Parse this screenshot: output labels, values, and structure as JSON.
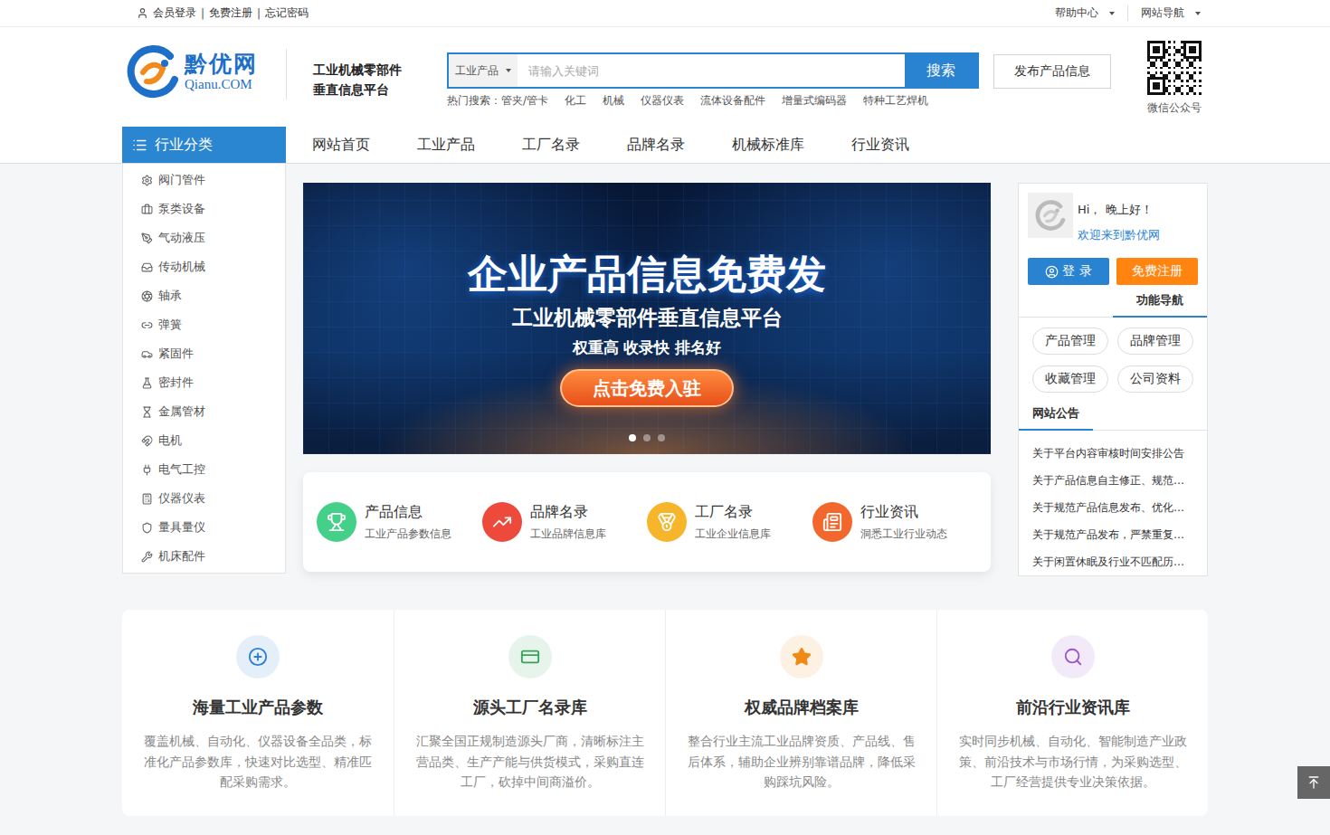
{
  "top_bar": {
    "left_links": [
      "会员登录",
      "免费注册",
      "忘记密码"
    ],
    "separator": "|",
    "right_menus": [
      "帮助中心",
      "网站导航"
    ]
  },
  "logo": {
    "name": "黔优网",
    "domain": "Qianu.COM"
  },
  "slogan": [
    "工业机械零部件",
    "垂直信息平台"
  ],
  "search": {
    "category": "工业产品",
    "placeholder": "请输入关键词",
    "button": "搜索",
    "hot_label": "热门搜索：",
    "hot": [
      "管夹/管卡",
      "化工",
      "机械",
      "仪器仪表",
      "流体设备配件",
      "增量式编码器",
      "特种工艺焊机"
    ]
  },
  "publish_button": "发布产品信息",
  "qr": {
    "caption": "微信公众号"
  },
  "category_title": "行业分类",
  "nav": [
    "网站首页",
    "工业产品",
    "工厂名录",
    "品牌名录",
    "机械标准库",
    "行业资讯"
  ],
  "sidebar": {
    "items": [
      "阀门管件",
      "泵类设备",
      "气动液压",
      "传动机械",
      "轴承",
      "弹簧",
      "紧固件",
      "密封件",
      "金属管材",
      "电机",
      "电气工控",
      "仪器仪表",
      "量具量仪",
      "机床配件"
    ]
  },
  "banner": {
    "title": "企业产品信息免费发",
    "subtitle": "工业机械零部件垂直信息平台",
    "tagline": "权重高 收录快 排名好",
    "button": "点击免费入驻",
    "dots": [
      {
        "selected": true
      },
      {
        "selected": false
      },
      {
        "selected": false
      }
    ]
  },
  "quick_links": [
    {
      "title": "产品信息",
      "desc": "工业产品参数信息",
      "color": "#45d08a"
    },
    {
      "title": "品牌名录",
      "desc": "工业品牌信息库",
      "color": "#ee4a3b"
    },
    {
      "title": "工厂名录",
      "desc": "工业企业信息库",
      "color": "#f6b52a"
    },
    {
      "title": "行业资讯",
      "desc": "洞悉工业行业动态",
      "color": "#f2682c"
    }
  ],
  "user_panel": {
    "greeting": "Hi， 晚上好！",
    "welcome": "欢迎来到黔优网",
    "login": "登 录",
    "register": "免费注册",
    "nav_title": "功能导航",
    "functions": [
      "产品管理",
      "品牌管理",
      "收藏管理",
      "公司资料"
    ],
    "notice_title": "网站公告",
    "notices": [
      "关于平台内容审核时间安排公告",
      "关于产品信息自主修正、规范…",
      "关于规范产品信息发布、优化…",
      "关于规范产品发布，严禁重复…",
      "关于闲置休眠及行业不匹配历…"
    ]
  },
  "features": [
    {
      "title": "海量工业产品参数",
      "desc": "覆盖机械、自动化、仪器设备全品类，标准化产品参数库，快速对比选型、精准匹配采购需求。",
      "color": "#2b7fd4"
    },
    {
      "title": "源头工厂名录库",
      "desc": "汇聚全国正规制造源头厂商，清晰标注主营品类、生产产能与供货模式，采购直连工厂，砍掉中间商溢价。",
      "color": "#35a35a"
    },
    {
      "title": "权威品牌档案库",
      "desc": "整合行业主流工业品牌资质、产品线、售后体系，辅助企业辨别靠谱品牌，降低采购踩坑风险。",
      "color": "#f08a17"
    },
    {
      "title": "前沿行业资讯库",
      "desc": "实时同步机械、自动化、智能制造产业政策、前沿技术与市场行情，为采购选型、工厂经营提供专业决策依据。",
      "color": "#9a55cf"
    }
  ]
}
